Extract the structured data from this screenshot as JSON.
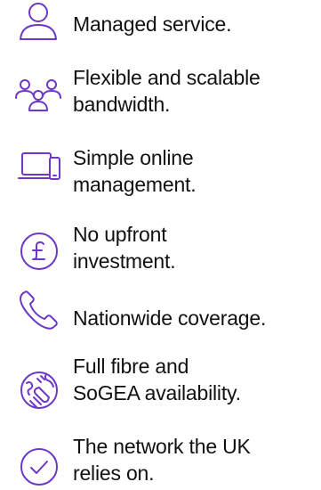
{
  "theme": {
    "icon_color": "#6d38c7",
    "text_color": "#111111"
  },
  "features": [
    {
      "icon": "user-icon",
      "lines": [
        "Managed service."
      ]
    },
    {
      "icon": "people-group-icon",
      "lines": [
        "Flexible and scalable",
        "bandwidth."
      ]
    },
    {
      "icon": "laptop-phone-icon",
      "lines": [
        "Simple online",
        "management."
      ]
    },
    {
      "icon": "pound-coin-icon",
      "lines": [
        "No upfront",
        "investment."
      ]
    },
    {
      "icon": "phone-handset-icon",
      "lines": [
        "Nationwide coverage."
      ]
    },
    {
      "icon": "globe-plug-icon",
      "lines": [
        "Full fibre and",
        "SoGEA availability."
      ]
    },
    {
      "icon": "check-circle-icon",
      "lines": [
        "The network the UK",
        "relies on."
      ]
    }
  ]
}
